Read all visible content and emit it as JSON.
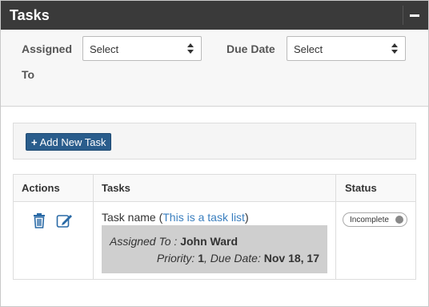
{
  "panel": {
    "title": "Tasks",
    "collapse_icon": "minus-icon"
  },
  "filters": {
    "assigned_label_line1": "Assigned",
    "assigned_label_line2": "To",
    "assigned_value": "Select",
    "due_label": "Due Date",
    "due_value": "Select"
  },
  "toolbar": {
    "add_label": "Add New Task",
    "add_icon": "plus-icon"
  },
  "table": {
    "headers": [
      "Actions",
      "Tasks",
      "Status"
    ],
    "rows": [
      {
        "task_name_prefix": "Task name (",
        "task_list_link": "This is a task list",
        "task_name_suffix": ")",
        "assigned_prefix": "Assigned To :",
        "assigned_name": "John Ward",
        "priority_label": "Priority:",
        "priority_value": "1",
        "due_label": "Due Date:",
        "due_value": "Nov 18, 17",
        "status": "Incomplete",
        "delete_icon": "trash-icon",
        "edit_icon": "edit-icon"
      }
    ]
  },
  "colors": {
    "titlebar": "#3a3a3a",
    "accent_button": "#2a5d8c",
    "icon_blue": "#2a6aa6",
    "link": "#3a7fbf"
  }
}
